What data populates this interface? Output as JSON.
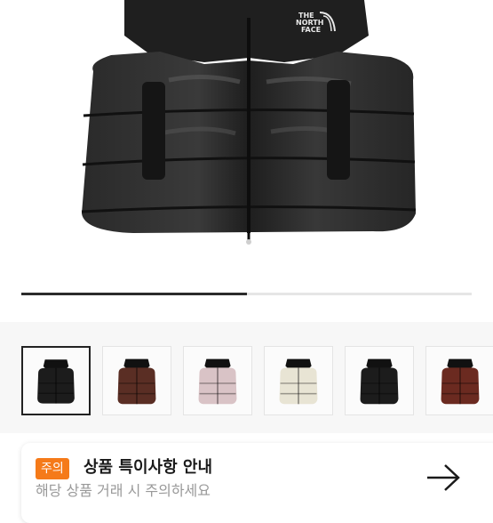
{
  "product_image": {
    "logo_lines": [
      "THE",
      "NORTH",
      "FACE"
    ],
    "brand_logo_name": "the-north-face-logo"
  },
  "gallery": {
    "progress_fraction": 0.5,
    "thumbnails": [
      {
        "name": "black-vest-front",
        "color": "#1c1c1c",
        "selected": true
      },
      {
        "name": "brown-vest-front",
        "color": "#5a2e24",
        "selected": false
      },
      {
        "name": "pink-vest-front",
        "color": "#d9c3c6",
        "selected": false
      },
      {
        "name": "cream-vest-front",
        "color": "#e8e4d4",
        "selected": false
      },
      {
        "name": "black-vest-alt",
        "color": "#1c1c1c",
        "selected": false
      },
      {
        "name": "brown-vest-alt",
        "color": "#6b2a20",
        "selected": false
      }
    ]
  },
  "notice": {
    "badge": "주의",
    "title": "상품 특이사항 안내",
    "subtitle": "해당 상품 거래 시 주의하세요",
    "arrow_icon": "arrow-right-icon",
    "badge_color": "#f57a19"
  }
}
